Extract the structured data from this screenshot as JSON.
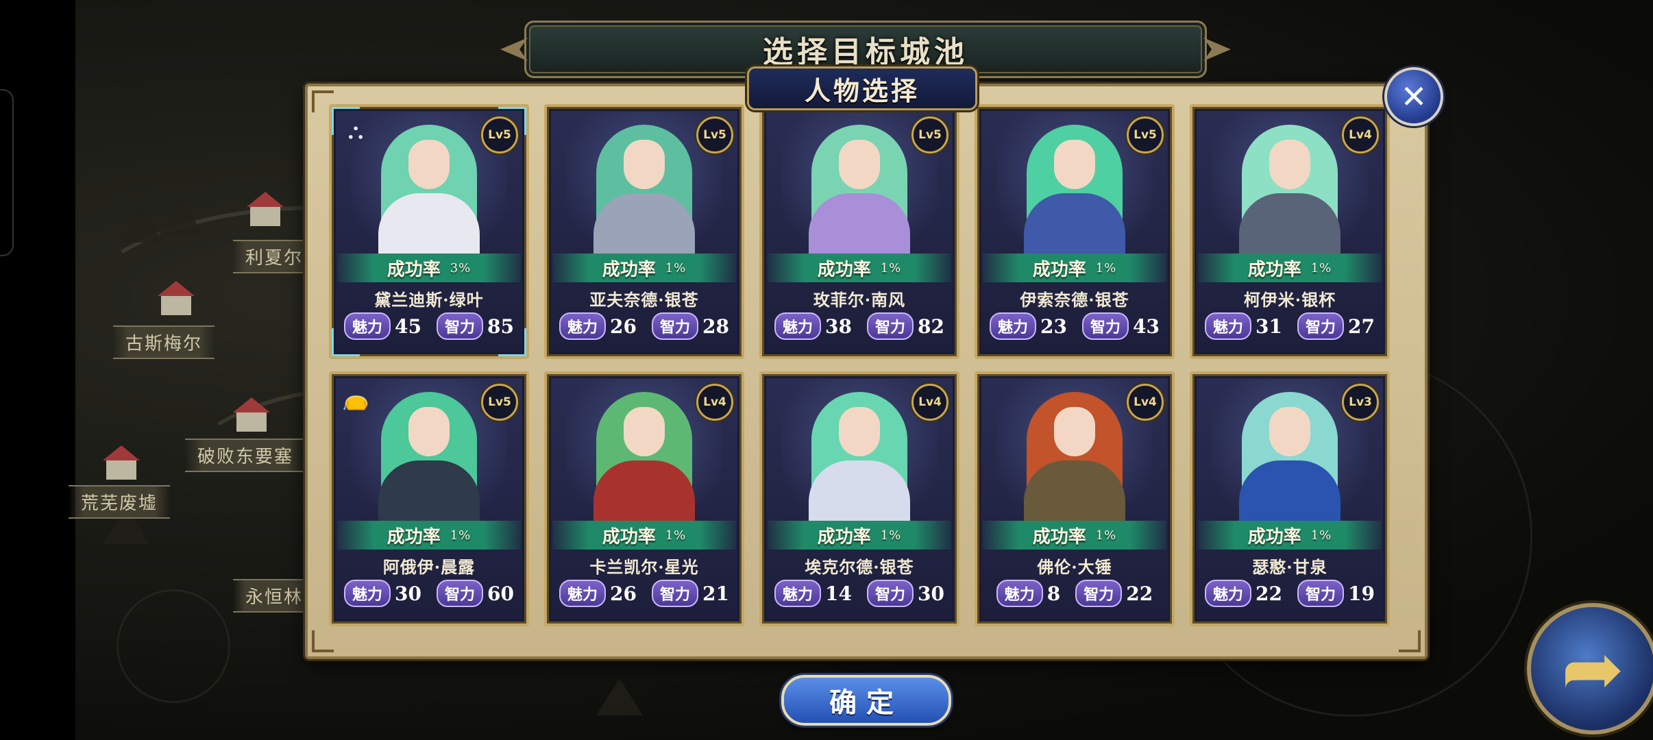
{
  "dialog": {
    "title": "选择目标城池",
    "subtitle": "人物选择",
    "close_icon": "✕",
    "confirm_label": "确定"
  },
  "map": {
    "labels": [
      "古斯梅尔",
      "破败东要塞",
      "荒芜废墟",
      "永恒林",
      "利夏尔"
    ]
  },
  "labels": {
    "rate": "成功率",
    "charm": "魅力",
    "intellect": "智力"
  },
  "characters": [
    {
      "name": "黛兰迪斯·绿叶",
      "level": "Lv5",
      "rate": "3%",
      "charm": "45",
      "intellect": "85",
      "hair": "#6fd2b0",
      "outfit": "#e8e8f0",
      "skill_icon": "tribe-icon",
      "selected": true
    },
    {
      "name": "亚夫奈德·银苍",
      "level": "Lv5",
      "rate": "1%",
      "charm": "26",
      "intellect": "28",
      "hair": "#5dbfa0",
      "outfit": "#9aa3b8"
    },
    {
      "name": "玫菲尔·南风",
      "level": "Lv5",
      "rate": "1%",
      "charm": "38",
      "intellect": "82",
      "hair": "#7ad4b2",
      "outfit": "#a98fd8"
    },
    {
      "name": "伊索奈德·银苍",
      "level": "Lv5",
      "rate": "1%",
      "charm": "23",
      "intellect": "43",
      "hair": "#4fd0a2",
      "outfit": "#3f5aa8"
    },
    {
      "name": "柯伊米·银杯",
      "level": "Lv4",
      "rate": "1%",
      "charm": "31",
      "intellect": "27",
      "hair": "#8ee0c4",
      "outfit": "#5a6478"
    },
    {
      "name": "阿俄伊·晨露",
      "level": "Lv5",
      "rate": "1%",
      "charm": "30",
      "intellect": "60",
      "hair": "#4cc89a",
      "outfit": "#2f3a4a",
      "skill_icon": "bag-icon"
    },
    {
      "name": "卡兰凯尔·星光",
      "level": "Lv4",
      "rate": "1%",
      "charm": "26",
      "intellect": "21",
      "hair": "#5db874",
      "outfit": "#a8332e"
    },
    {
      "name": "埃克尔德·银苍",
      "level": "Lv4",
      "rate": "1%",
      "charm": "14",
      "intellect": "30",
      "hair": "#68d6b0",
      "outfit": "#d6dcec"
    },
    {
      "name": "佛伦·大锤",
      "level": "Lv4",
      "rate": "1%",
      "charm": "8",
      "intellect": "22",
      "hair": "#c2532a",
      "outfit": "#6a5a3c"
    },
    {
      "name": "瑟憨·甘泉",
      "level": "Lv3",
      "rate": "1%",
      "charm": "22",
      "intellect": "19",
      "hair": "#8ad8d0",
      "outfit": "#2a54b0"
    }
  ]
}
